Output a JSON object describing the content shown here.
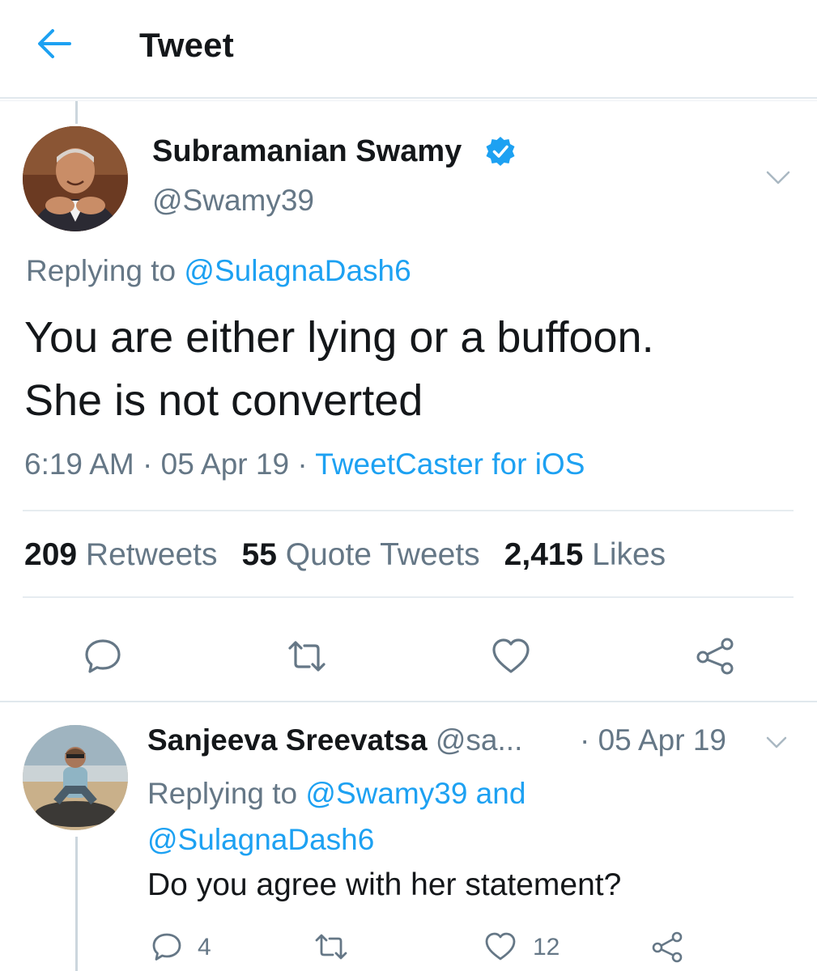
{
  "header": {
    "title": "Tweet",
    "back_icon": "back-arrow-icon"
  },
  "colors": {
    "accent": "#1da1f2",
    "secondary_text": "#657786",
    "primary_text": "#14171a",
    "divider": "#e6ecf0"
  },
  "main_tweet": {
    "display_name": "Subramanian Swamy",
    "verified": true,
    "handle": "@Swamy39",
    "replying_prefix": "Replying to ",
    "replying_to": "@SulagnaDash6",
    "text_line1": "You are either lying or a buffoon.",
    "text_line2": "She is not converted",
    "time": "6:19 AM",
    "separator": " · ",
    "date": "05 Apr 19",
    "source": "TweetCaster for iOS",
    "stats": {
      "retweets_count": "209",
      "retweets_label": "Retweets",
      "quotes_count": "55",
      "quotes_label": "Quote Tweets",
      "likes_count": "2,415",
      "likes_label": "Likes"
    },
    "actions": [
      "reply-icon",
      "retweet-icon",
      "like-icon",
      "share-icon"
    ]
  },
  "reply_tweet": {
    "display_name": "Sanjeeva Sreevatsa",
    "handle": "@sa...",
    "date": "· 05 Apr 19",
    "replying_prefix": "Replying to ",
    "replying_to_1": "@Swamy39",
    "replying_and": " and",
    "replying_to_2": "@SulagnaDash6",
    "text": "Do you agree with her statement?",
    "reply_count": "4",
    "retweet_count": "",
    "like_count": "12"
  }
}
